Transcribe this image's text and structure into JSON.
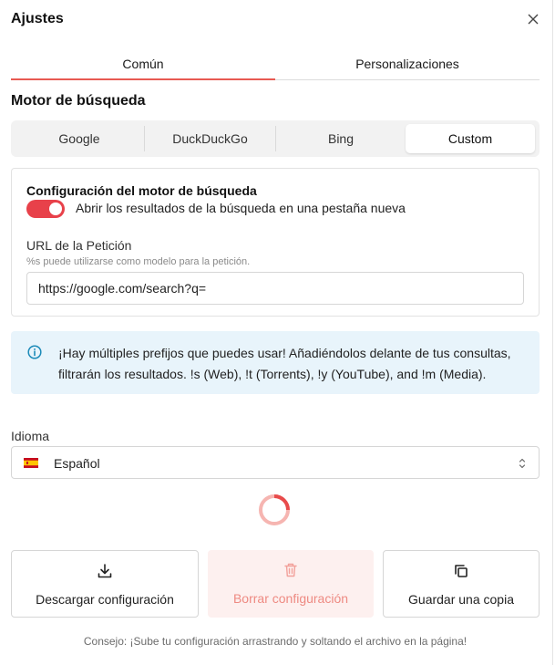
{
  "dialog": {
    "title": "Ajustes"
  },
  "tabs": [
    {
      "label": "Común",
      "active": true
    },
    {
      "label": "Personalizaciones",
      "active": false
    }
  ],
  "search_engine": {
    "section_title": "Motor de búsqueda",
    "options": [
      {
        "label": "Google",
        "selected": false
      },
      {
        "label": "DuckDuckGo",
        "selected": false
      },
      {
        "label": "Bing",
        "selected": false
      },
      {
        "label": "Custom",
        "selected": true
      }
    ]
  },
  "config": {
    "title": "Configuración del motor de búsqueda",
    "toggle_label": "Abrir los resultados de la búsqueda en una pestaña nueva",
    "toggle_on": true,
    "url_label": "URL de la Petición",
    "url_hint": "%s puede utilizarse como modelo para la petición.",
    "url_value": "https://google.com/search?q="
  },
  "info": {
    "text": "¡Hay múltiples prefijos que puedes usar! Añadiéndolos delante de tus consultas, filtrarán los resultados. !s (Web), !t (Torrents), !y (YouTube), and !m (Media)."
  },
  "language": {
    "label": "Idioma",
    "selected": "Español",
    "flag_icon": "spain-flag-icon"
  },
  "actions": [
    {
      "label": "Descargar configuración",
      "icon": "download-icon"
    },
    {
      "label": "Borrar configuración",
      "icon": "trash-icon",
      "disabled": true
    },
    {
      "label": "Guardar una copia",
      "icon": "copy-icon"
    }
  ],
  "tip": "Consejo: ¡Sube tu configuración arrastrando y soltando el archivo en la página!",
  "colors": {
    "accent": "#e8414a",
    "tab_underline": "#e85a52",
    "info_bg": "#e8f4fb",
    "info_icon": "#1b8ab8",
    "danger_bg": "#fdf0ef",
    "danger_text": "#ee8a82"
  }
}
